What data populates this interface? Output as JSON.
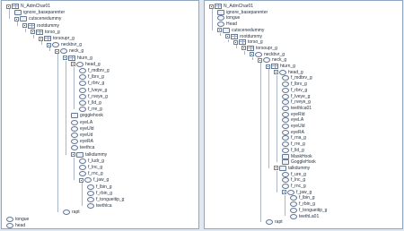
{
  "colors": {
    "background": "#dfe8f2",
    "panel": "#ffffff",
    "border": "#8fa7c4",
    "text": "#253344"
  },
  "left_tree": [
    {
      "label": "N_AdmChar01",
      "icon": "grid",
      "depth": 0,
      "expand": true
    },
    {
      "label": "ignore_baseparenter",
      "icon": "box",
      "depth": 1,
      "expand": false
    },
    {
      "label": "cutscenedummy",
      "icon": "box",
      "depth": 1,
      "expand": true
    },
    {
      "label": "rootdummy",
      "icon": "grid",
      "depth": 2,
      "expand": true
    },
    {
      "label": "torso_g",
      "icon": "grid",
      "depth": 3,
      "expand": true
    },
    {
      "label": "torsoupr_g",
      "icon": "grid",
      "depth": 4,
      "expand": true
    },
    {
      "label": "neckbvr_g",
      "icon": "circle",
      "depth": 5,
      "expand": true
    },
    {
      "label": "neck_g",
      "icon": "circle",
      "depth": 6,
      "expand": true
    },
    {
      "label": "hturn_g",
      "icon": "grid",
      "depth": 7,
      "expand": true
    },
    {
      "label": "head_g",
      "icon": "circle",
      "depth": 8,
      "expand": true
    },
    {
      "label": "f_mdbrv_g",
      "icon": "circle",
      "depth": 9,
      "expand": false
    },
    {
      "label": "f_lbrv_g",
      "icon": "circle",
      "depth": 9,
      "expand": false
    },
    {
      "label": "f_rbrv_g",
      "icon": "circle",
      "depth": 9,
      "expand": false
    },
    {
      "label": "f_lveye_g",
      "icon": "circle",
      "depth": 9,
      "expand": false
    },
    {
      "label": "f_rveye_g",
      "icon": "circle",
      "depth": 9,
      "expand": false
    },
    {
      "label": "f_lld_g",
      "icon": "circle",
      "depth": 9,
      "expand": false
    },
    {
      "label": "f_rre_g",
      "icon": "circle",
      "depth": 9,
      "expand": false
    },
    {
      "label": "gogglehook",
      "icon": "box",
      "depth": 8,
      "expand": false
    },
    {
      "label": "eyeLA",
      "icon": "circle",
      "depth": 8,
      "expand": false
    },
    {
      "label": "eyeUld",
      "icon": "circle",
      "depth": 8,
      "expand": false
    },
    {
      "label": "eyeUd",
      "icon": "circle",
      "depth": 8,
      "expand": false
    },
    {
      "label": "eyeRA",
      "icon": "circle",
      "depth": 8,
      "expand": false
    },
    {
      "label": "teethca",
      "icon": "circle",
      "depth": 8,
      "expand": false
    },
    {
      "label": "talkdummy",
      "icon": "box",
      "depth": 8,
      "expand": true
    },
    {
      "label": "f_ludr_g",
      "icon": "circle",
      "depth": 9,
      "expand": false
    },
    {
      "label": "f_lnc_g",
      "icon": "circle",
      "depth": 9,
      "expand": false
    },
    {
      "label": "f_rnc_g",
      "icon": "circle",
      "depth": 9,
      "expand": false
    },
    {
      "label": "f_jaw_g",
      "icon": "circle",
      "depth": 9,
      "expand": true
    },
    {
      "label": "f_lbin_g",
      "icon": "circle",
      "depth": 10,
      "expand": false
    },
    {
      "label": "f_rbin_g",
      "icon": "circle",
      "depth": 10,
      "expand": false
    },
    {
      "label": "f_tongueitip_g",
      "icon": "circle",
      "depth": 10,
      "expand": false
    },
    {
      "label": "teethlca",
      "icon": "circle",
      "depth": 10,
      "expand": false
    },
    {
      "label": "rapt",
      "icon": "circle",
      "depth": 7,
      "expand": false
    },
    {
      "label": "tongue",
      "icon": "circle",
      "depth": 0,
      "expand": false
    },
    {
      "label": "head",
      "icon": "circle",
      "depth": 0,
      "expand": false
    }
  ],
  "right_tree": [
    {
      "label": "N_AdmChar01",
      "icon": "grid",
      "depth": 0,
      "expand": true
    },
    {
      "label": "ignore_baseparenter",
      "icon": "box",
      "depth": 1,
      "expand": false
    },
    {
      "label": "tongue",
      "icon": "circle",
      "depth": 1,
      "expand": false
    },
    {
      "label": "Head",
      "icon": "circle",
      "depth": 1,
      "expand": false
    },
    {
      "label": "cutscenedummy",
      "icon": "box",
      "depth": 1,
      "expand": true
    },
    {
      "label": "rootdummy",
      "icon": "grid",
      "depth": 2,
      "expand": true
    },
    {
      "label": "torso_g",
      "icon": "grid",
      "depth": 3,
      "expand": true
    },
    {
      "label": "torsoupr_g",
      "icon": "grid",
      "depth": 4,
      "expand": true
    },
    {
      "label": "neckbvr_g",
      "icon": "circle",
      "depth": 5,
      "expand": true
    },
    {
      "label": "neck_g",
      "icon": "circle",
      "depth": 6,
      "expand": true
    },
    {
      "label": "hturn_g",
      "icon": "grid",
      "depth": 7,
      "expand": true
    },
    {
      "label": "head_g",
      "icon": "circle",
      "depth": 8,
      "expand": true
    },
    {
      "label": "f_mdbrv_g",
      "icon": "circle",
      "depth": 9,
      "expand": false
    },
    {
      "label": "f_lbrv_g",
      "icon": "circle",
      "depth": 9,
      "expand": false
    },
    {
      "label": "f_rbrv_g",
      "icon": "circle",
      "depth": 9,
      "expand": false
    },
    {
      "label": "f_lveye_g",
      "icon": "circle",
      "depth": 9,
      "expand": false
    },
    {
      "label": "f_rveye_g",
      "icon": "circle",
      "depth": 9,
      "expand": false
    },
    {
      "label": "teethlca01",
      "icon": "circle",
      "depth": 9,
      "expand": false
    },
    {
      "label": "eyeRld",
      "icon": "circle",
      "depth": 9,
      "expand": false
    },
    {
      "label": "eyeLA",
      "icon": "circle",
      "depth": 9,
      "expand": false
    },
    {
      "label": "eyeUld",
      "icon": "circle",
      "depth": 9,
      "expand": false
    },
    {
      "label": "eyeRA",
      "icon": "circle",
      "depth": 9,
      "expand": false
    },
    {
      "label": "f_rna_g",
      "icon": "circle",
      "depth": 9,
      "expand": false
    },
    {
      "label": "f_rre_g",
      "icon": "circle",
      "depth": 9,
      "expand": false
    },
    {
      "label": "f_lld_g",
      "icon": "circle",
      "depth": 9,
      "expand": false
    },
    {
      "label": "MaskHook",
      "icon": "box",
      "depth": 9,
      "expand": false
    },
    {
      "label": "GoggleHook",
      "icon": "box",
      "depth": 9,
      "expand": false
    },
    {
      "label": "talkdummy",
      "icon": "box",
      "depth": 8,
      "expand": true
    },
    {
      "label": "f_ure_g",
      "icon": "circle",
      "depth": 9,
      "expand": false
    },
    {
      "label": "f_lnc_g",
      "icon": "circle",
      "depth": 9,
      "expand": false
    },
    {
      "label": "f_rnc_g",
      "icon": "circle",
      "depth": 9,
      "expand": false
    },
    {
      "label": "f_jaw_g",
      "icon": "circle",
      "depth": 9,
      "expand": true
    },
    {
      "label": "f_lbin_g",
      "icon": "circle",
      "depth": 10,
      "expand": false
    },
    {
      "label": "f_rbin_g",
      "icon": "circle",
      "depth": 10,
      "expand": false
    },
    {
      "label": "f_tongueitip_g",
      "icon": "circle",
      "depth": 10,
      "expand": false
    },
    {
      "label": "teethLa01",
      "icon": "circle",
      "depth": 10,
      "expand": false
    },
    {
      "label": "rapt",
      "icon": "circle",
      "depth": 7,
      "expand": false
    }
  ]
}
